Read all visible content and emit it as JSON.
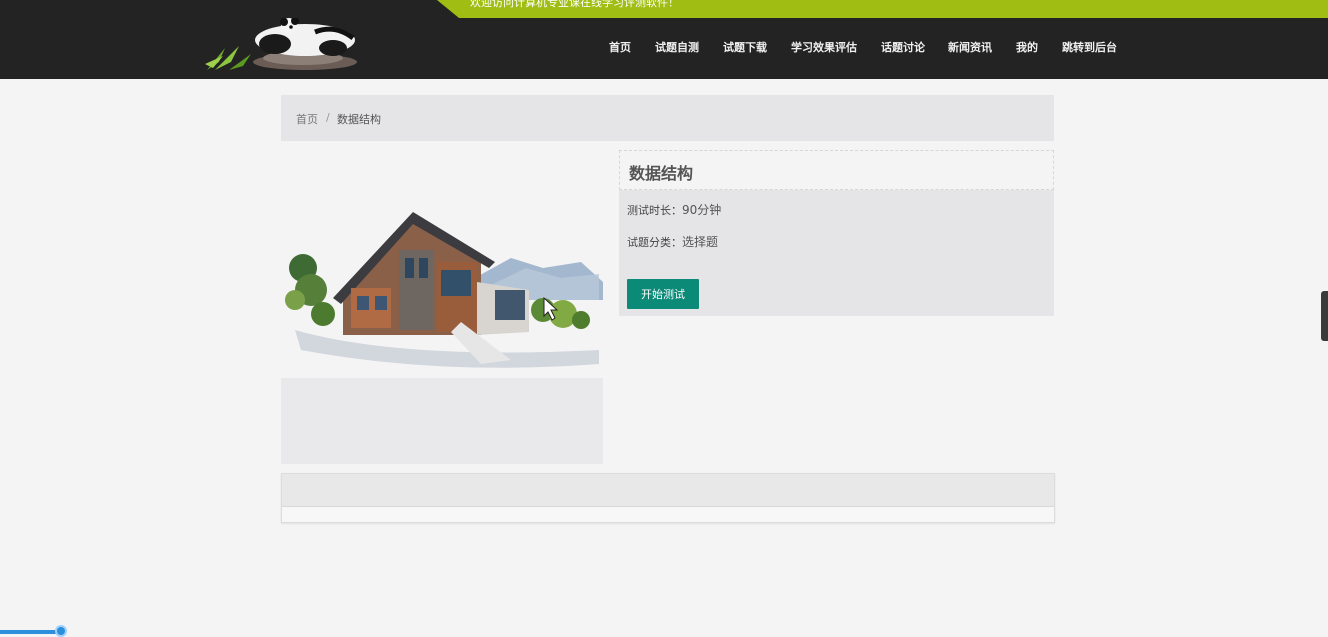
{
  "header": {
    "welcome": "欢迎访问计算机专业课在线学习评测软件！",
    "logo_icon": "panda-logo-icon",
    "nav": [
      {
        "label": "首页"
      },
      {
        "label": "试题自测"
      },
      {
        "label": "试题下载"
      },
      {
        "label": "学习效果评估"
      },
      {
        "label": "话题讨论"
      },
      {
        "label": "新闻资讯"
      },
      {
        "label": "我的"
      },
      {
        "label": "跳转到后台"
      }
    ]
  },
  "breadcrumb": {
    "home": "首页",
    "separator": "/",
    "current": "数据结构"
  },
  "exam": {
    "cover_icon": "house-illustration",
    "title": "数据结构",
    "duration_label": "测试时长：",
    "duration_value": "90分钟",
    "category_label": "试题分类：",
    "category_value": "选择题",
    "start_button": "开始测试"
  },
  "colors": {
    "header_bg": "#232323",
    "accent_green": "#9fbd12",
    "button_teal": "#0c8a78"
  }
}
